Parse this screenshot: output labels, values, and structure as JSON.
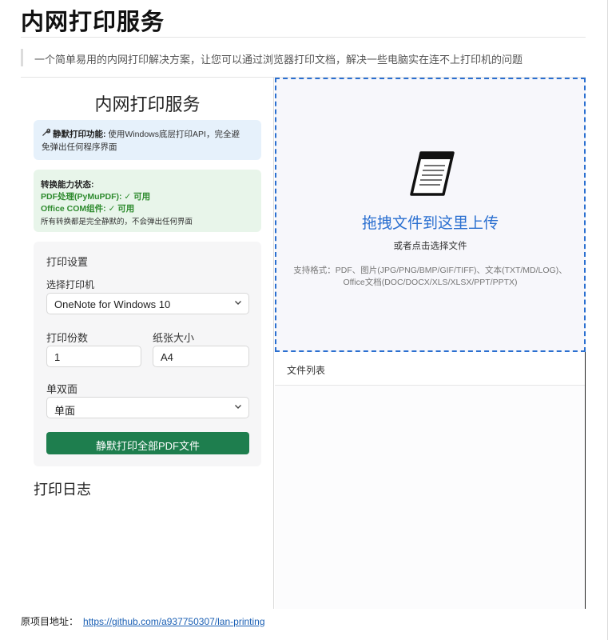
{
  "page": {
    "title": "内网打印服务",
    "subtitle": "一个简单易用的内网打印解决方案，让您可以通过浏览器打印文档，解决一些电脑实在连不上打印机的问题"
  },
  "app": {
    "heading": "内网打印服务",
    "silent_info": {
      "title": "静默打印功能:",
      "line1_rest": "使用Windows底层打印API，完全避",
      "line2": "免弹出任何程序界面"
    },
    "status": {
      "title": "转换能力状态:",
      "pdf": "PDF处理(PyMuPDF): ✓ 可用",
      "office": "Office COM组件: ✓ 可用",
      "note": "所有转换都是完全静默的，不会弹出任何界面"
    },
    "settings": {
      "title": "打印设置",
      "printer_label": "选择打印机",
      "printer_value": "OneNote for Windows 10",
      "copies_label": "打印份数",
      "copies_value": "1",
      "paper_label": "纸张大小",
      "paper_value": "A4",
      "duplex_label": "单双面",
      "duplex_value": "单面",
      "print_button": "静默打印全部PDF文件"
    },
    "log_heading": "打印日志",
    "dropzone": {
      "main": "拖拽文件到这里上传",
      "sub": "或者点击选择文件",
      "formats_line1": "支持格式：PDF、图片(JPG/PNG/BMP/GIF/TIFF)、文本(TXT/MD/LOG)、",
      "formats_line2": "Office文档(DOC/DOCX/XLS/XLSX/PPT/PPTX)"
    },
    "file_list_title": "文件列表"
  },
  "footer": {
    "label": "原项目地址：",
    "link": "https://github.com/a937750307/lan-printing"
  },
  "colors": {
    "accent_blue": "#2a6fd0",
    "button_green": "#1e7e4e",
    "status_green": "#2e8b2e",
    "info_blue_bg": "#e6f1fb",
    "info_green_bg": "#e8f5ea"
  },
  "icons": {
    "silent_info": "wrench-icon",
    "dropzone": "document-icon",
    "select": "chevron-down-icon"
  }
}
